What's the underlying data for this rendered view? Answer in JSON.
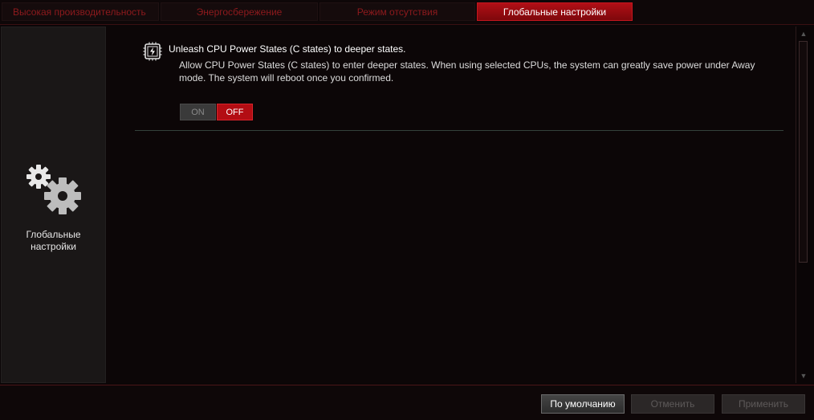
{
  "tabs": [
    {
      "label": "Высокая производительность",
      "active": false
    },
    {
      "label": "Энергосбережение",
      "active": false
    },
    {
      "label": "Режим отсутствия",
      "active": false
    },
    {
      "label": "Глобальные настройки",
      "active": true
    }
  ],
  "sidebar": {
    "label": "Глобальные\nнастройки",
    "icon": "gears-icon"
  },
  "feature": {
    "icon": "cpu-power-icon",
    "title": "Unleash CPU Power States (C states) to deeper states.",
    "description": "Allow CPU Power States (C states) to enter deeper states. When using selected CPUs, the system can greatly save power under Away mode. The system will reboot once you confirmed.",
    "toggle": {
      "on_label": "ON",
      "off_label": "OFF",
      "selected": "OFF"
    }
  },
  "footer": {
    "default_label": "По умолчанию",
    "cancel_label": "Отменить",
    "apply_label": "Применить"
  },
  "colors": {
    "accent": "#b30d13",
    "background": "#0b0607"
  }
}
